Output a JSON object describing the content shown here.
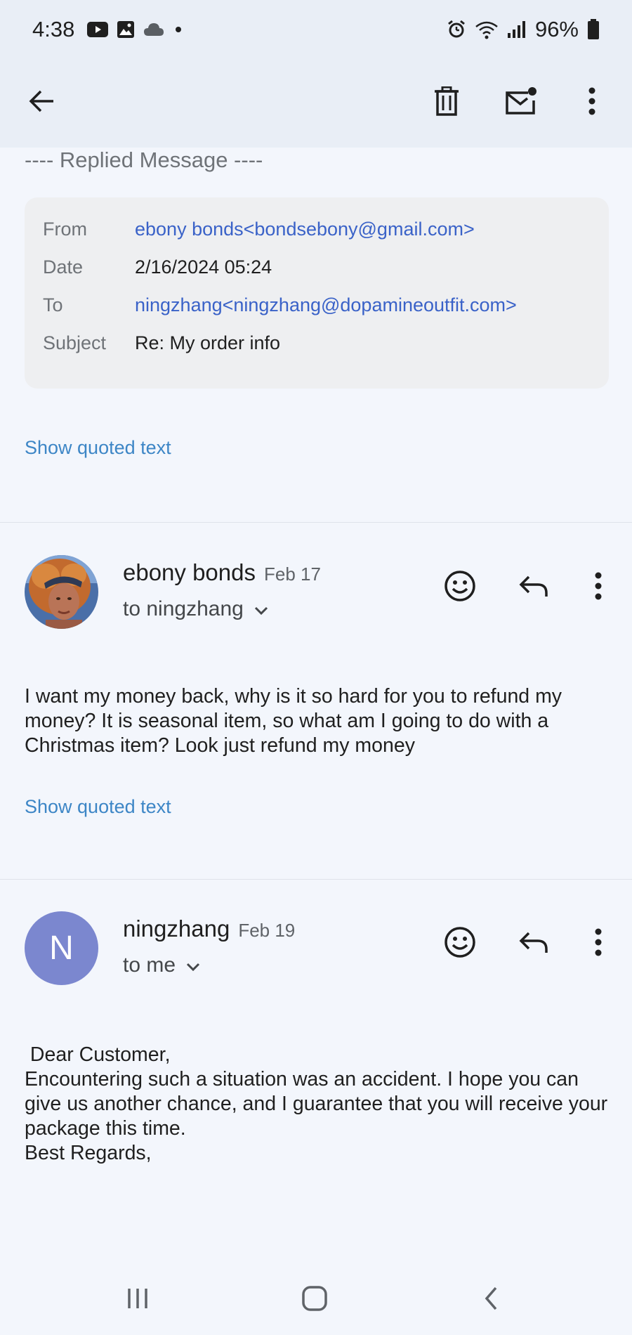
{
  "status_bar": {
    "time": "4:38",
    "battery": "96%",
    "left_icons": [
      "youtube-icon",
      "gallery-icon",
      "cloud-icon",
      "dot-icon"
    ],
    "right_icons": [
      "alarm-icon",
      "wifi-icon",
      "signal-icon",
      "battery-icon"
    ]
  },
  "app_bar": {
    "icons": [
      "back-arrow-icon",
      "delete-icon",
      "mark-unread-icon",
      "more-vert-icon"
    ]
  },
  "replied_message": {
    "header": "---- Replied Message ----",
    "fields": [
      {
        "label": "From",
        "value": "ebony bonds<bondsebony@gmail.com>",
        "link": true
      },
      {
        "label": "Date",
        "value": "2/16/2024 05:24",
        "link": false
      },
      {
        "label": "To",
        "value": "ningzhang<ningzhang@dopamineoutfit.com>",
        "link": true
      },
      {
        "label": "Subject",
        "value": "Re: My order info",
        "link": false
      }
    ],
    "show_quoted": "Show quoted text"
  },
  "messages": [
    {
      "sender": "ebony bonds",
      "date": "Feb 17",
      "recipient": "to ningzhang",
      "avatar_type": "photo",
      "body": "I want my money back, why is it so hard for you to refund my money?  It is seasonal item,  so what am I going to do with a Christmas item? Look just refund my money",
      "show_quoted": "Show quoted text"
    },
    {
      "sender": "ningzhang",
      "date": "Feb 19",
      "recipient": "to me",
      "avatar_type": "letter",
      "avatar_letter": "N",
      "body_lines": [
        " Dear Customer,",
        "Encountering such a situation was an accident. I hope you can give us another chance, and I guarantee that you will receive your package this time.",
        "Best Regards,"
      ]
    }
  ],
  "nav_bar": {
    "icons": [
      "recent-apps-icon",
      "home-icon",
      "back-icon"
    ]
  },
  "colors": {
    "background": "#f3f6fc",
    "header_background": "#e9eef6",
    "link": "#3a62c8",
    "show_quoted": "#3d86c6",
    "avatar_letter_bg": "#7b87cf"
  }
}
